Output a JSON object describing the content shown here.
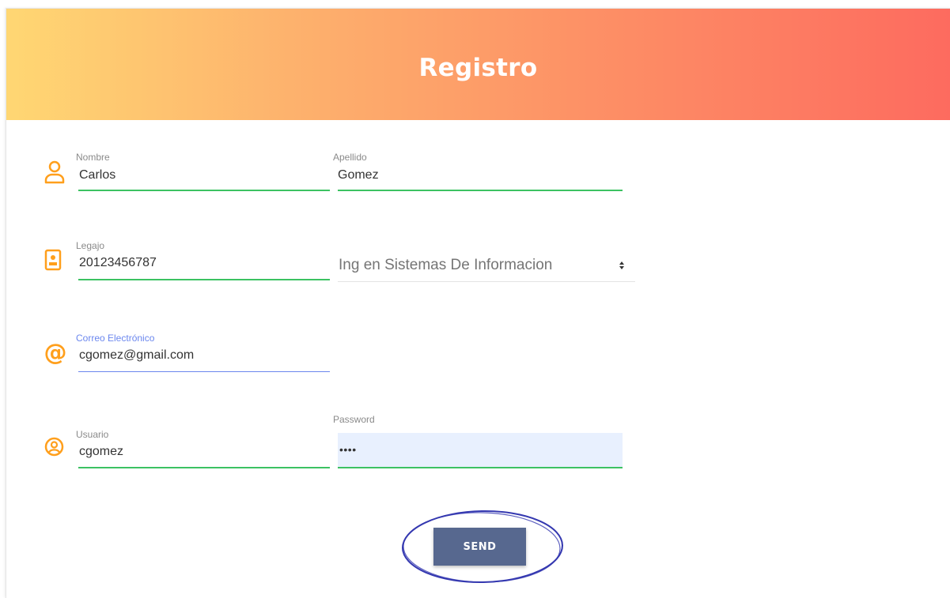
{
  "header": {
    "title": "Registro"
  },
  "form": {
    "nombre": {
      "label": "Nombre",
      "value": "Carlos"
    },
    "apellido": {
      "label": "Apellido",
      "value": "Gomez"
    },
    "legajo": {
      "label": "Legajo",
      "value": "20123456787"
    },
    "carrera": {
      "selected": "Ing en Sistemas De Informacion"
    },
    "correo": {
      "label": "Correo Electrónico",
      "value": "cgomez@gmail.com"
    },
    "usuario": {
      "label": "Usuario",
      "value": "cgomez"
    },
    "password": {
      "label": "Password",
      "value": "••••"
    },
    "send_label": "SEND"
  },
  "icons": {
    "nombre": "person-icon",
    "legajo": "id-badge-icon",
    "correo": "at-sign-icon",
    "usuario": "user-circle-icon",
    "select": "sort-arrows-icon"
  },
  "colors": {
    "icon": "#ff9f1c",
    "valid_underline": "#3cc262",
    "focus_underline": "#6b87ee",
    "button": "#57688f",
    "annotation": "#3438b0",
    "header_gradient": [
      "#ffd773",
      "#fd6b5f"
    ]
  }
}
